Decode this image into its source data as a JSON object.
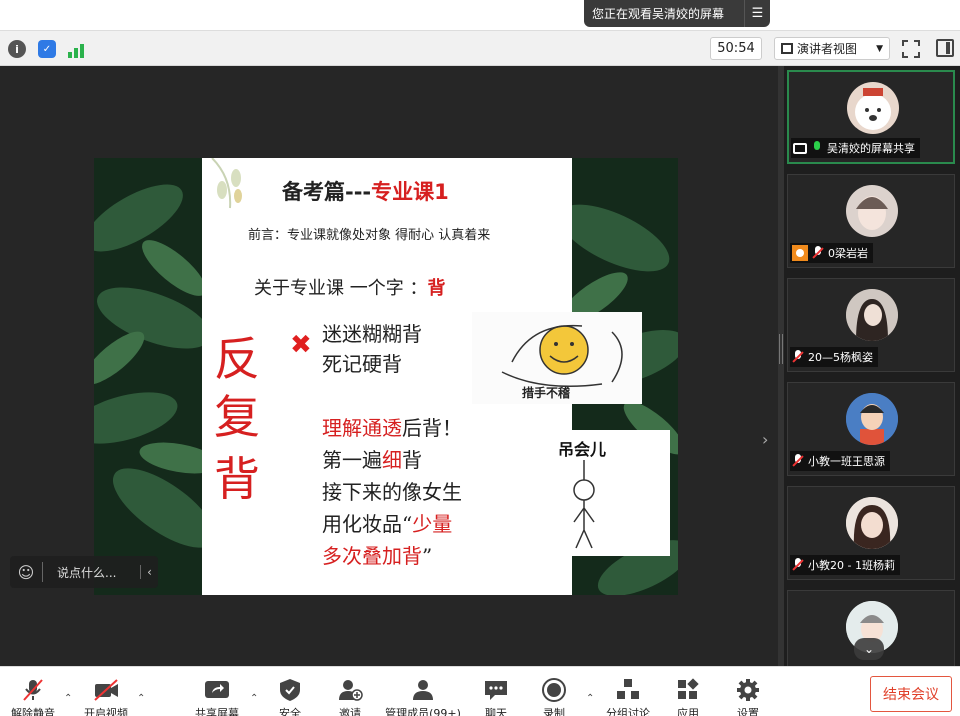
{
  "banner": {
    "share_status": "您正在观看吴清姣的屏幕"
  },
  "toolbar": {
    "timer": "50:54",
    "view_mode": "演讲者视图"
  },
  "slide": {
    "title_prefix": "备考篇---",
    "title_highlight": "专业课1",
    "intro": "前言：专业课就像处对象 得耐心  认真着来",
    "about_prefix": "关于专业课  一个字 ：",
    "about_highlight": "背",
    "big_chars": [
      "反",
      "复",
      "背"
    ],
    "wrong_methods": [
      "迷迷糊糊背",
      "死记硬背"
    ],
    "meme1_caption": "措手不稽",
    "meme2_caption": "吊会儿",
    "right_line1_red": "理解通透",
    "right_line1_rest": "后背！",
    "right_line2_pre": "第一遍",
    "right_line2_red": "细",
    "right_line2_post": "背",
    "right_line3": "接下来的像女生",
    "right_line4_pre": "用化妆品“",
    "right_line4_red": "少量",
    "right_line5_red": "多次叠加背",
    "right_line5_post": "”"
  },
  "chat": {
    "placeholder": "说点什么..."
  },
  "participants": [
    {
      "name": "吴清姣的屏幕共享",
      "status": "mic-on",
      "avatar_color": "#e8d7cc"
    },
    {
      "name": "0梁岩岩",
      "status": "muted",
      "avatar_color": "#dcd2cd"
    },
    {
      "name": "20—5杨枫姿",
      "status": "muted",
      "avatar_color": "#6f6560"
    },
    {
      "name": "小教一班王思源",
      "status": "muted",
      "avatar_color": "#3f6eb4"
    },
    {
      "name": "小教20 - 1班杨莉",
      "status": "muted",
      "avatar_color": "#d8c2b6"
    },
    {
      "name": "",
      "status": "",
      "avatar_color": "#d9e6e6"
    }
  ],
  "bottom": {
    "unmute": "解除静音",
    "video": "开启视频",
    "share": "共享屏幕",
    "security": "安全",
    "invite": "邀请",
    "participants": "管理成员(99+)",
    "chat": "聊天",
    "record": "录制",
    "breakout": "分组讨论",
    "apps": "应用",
    "settings": "设置",
    "end": "结束会议"
  },
  "colors": {
    "accent_red": "#d62020",
    "end_red": "#e0402a",
    "active_green": "#2a8a4d"
  }
}
